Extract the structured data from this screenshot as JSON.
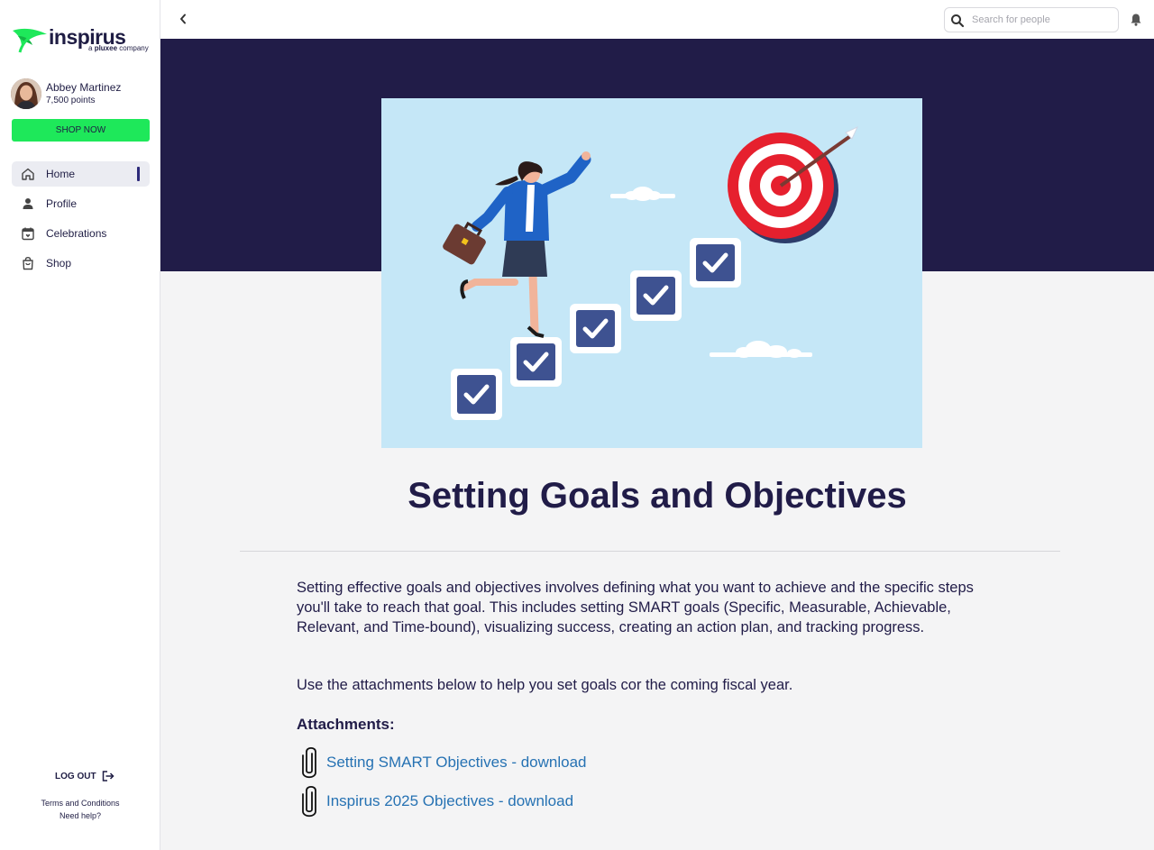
{
  "brand": {
    "name": "inspirus",
    "tagline_prefix": "a",
    "tagline_brand": "pluxee",
    "tagline_suffix": "company",
    "accent_color": "#1ee85a",
    "banner_color": "#211c48",
    "link_color": "#2672b3"
  },
  "user": {
    "name": "Abbey Martinez",
    "points": "7,500 points"
  },
  "sidebar": {
    "shop_now": "SHOP NOW",
    "items": [
      {
        "label": "Home",
        "icon": "home-icon",
        "active": true
      },
      {
        "label": "Profile",
        "icon": "person-icon",
        "active": false
      },
      {
        "label": "Celebrations",
        "icon": "calendar-icon",
        "active": false
      },
      {
        "label": "Shop",
        "icon": "shopping-bag-icon",
        "active": false
      }
    ],
    "logout": "LOG OUT",
    "terms": "Terms and Conditions",
    "help": "Need help?"
  },
  "topbar": {
    "search_placeholder": "Search for people"
  },
  "article": {
    "title": "Setting Goals and Objectives",
    "paragraph1": "Setting effective goals and objectives involves defining what you want to achieve and the specific steps you'll take to reach that goal. This includes setting SMART goals (Specific, Measurable, Achievable, Relevant, and Time-bound), visualizing success, creating an action plan, and tracking progress.",
    "paragraph2": "Use the attachments below to help you set goals cor the coming fiscal year.",
    "attachments_heading": "Attachments:",
    "attachments": [
      {
        "label": "Setting SMART Objectives - download",
        "icon": "paperclip-icon"
      },
      {
        "label": "Inspirus 2025 Objectives - download",
        "icon": "paperclip-icon"
      }
    ]
  }
}
